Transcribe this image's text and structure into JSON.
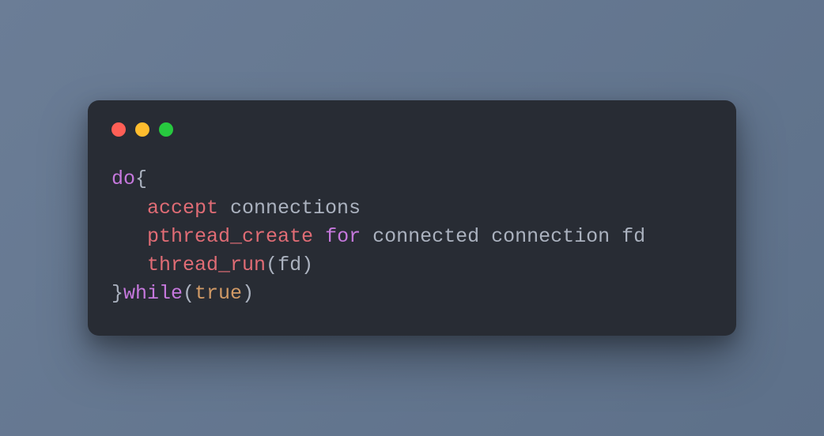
{
  "code": {
    "line1_kw": "do",
    "line1_brace": "{",
    "indent": "   ",
    "line2_fn": "accept",
    "line2_rest": " connections",
    "line3_fn": "pthread_create",
    "line3_sp": " ",
    "line3_kw": "for",
    "line3_rest": " connected connection fd",
    "line4_fn": "thread_run",
    "line4_paren_open": "(",
    "line4_arg": "fd",
    "line4_paren_close": ")",
    "line5_brace": "}",
    "line5_kw": "while",
    "line5_paren_open": "(",
    "line5_lit": "true",
    "line5_paren_close": ")"
  }
}
